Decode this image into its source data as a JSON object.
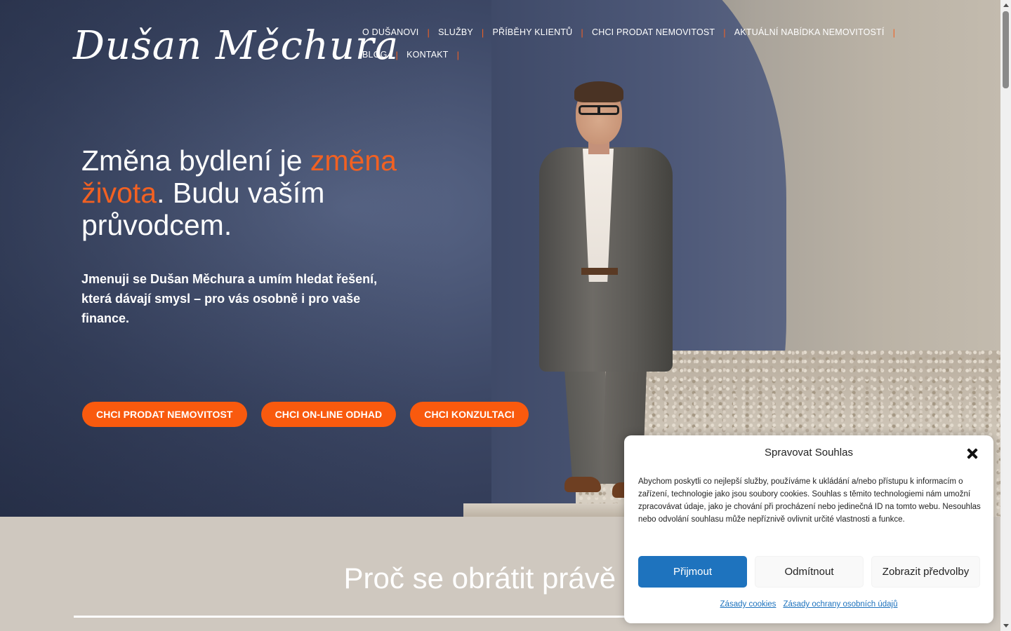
{
  "header": {
    "logo_text": "Dušan Měchura",
    "nav": [
      {
        "label": "O Dušanovi"
      },
      {
        "label": "Služby"
      },
      {
        "label": "Příběhy klientů"
      },
      {
        "label": "Chci prodat nemovitost"
      },
      {
        "label": "Aktuální nabídka nemovitostí"
      },
      {
        "label": "Blog"
      },
      {
        "label": "Kontakt"
      }
    ],
    "separator": "|"
  },
  "hero": {
    "headline_part1": "Změna bydlení je ",
    "headline_accent": "změna života",
    "headline_part2": ". Budu vaším průvodcem.",
    "intro": "Jmenuji se Dušan Měchura a umím hledat řešení, která dávají smysl – pro vás osobně i pro vaše finance.",
    "ctas": [
      {
        "label": "CHCI PRODAT NEMOVITOST"
      },
      {
        "label": "CHCI ON-LINE ODHAD"
      },
      {
        "label": "CHCI KONZULTACI"
      }
    ]
  },
  "section": {
    "heading": "Proč se obrátit právě na"
  },
  "cookie_modal": {
    "title": "Spravovat Souhlas",
    "text": "Abychom poskytli co nejlepší služby, používáme k ukládání a/nebo přístupu k informacím o zařízení, technologie jako jsou soubory cookies. Souhlas s těmito technologiemi nám umožní zpracovávat údaje, jako je chování při procházení nebo jedinečná ID na tomto webu. Nesouhlas nebo odvolání souhlasu může nepříznivě ovlivnit určité vlastnosti a funkce.",
    "accept_label": "Přijmout",
    "deny_label": "Odmítnout",
    "prefs_label": "Zobrazit předvolby",
    "link_cookies": "Zásady cookies",
    "link_privacy": "Zásady ochrany osobních údajů"
  },
  "colors": {
    "accent": "#f26122",
    "cta": "#f95a0e",
    "primary_button": "#1e73be",
    "section_bg": "#cfc8bf"
  }
}
